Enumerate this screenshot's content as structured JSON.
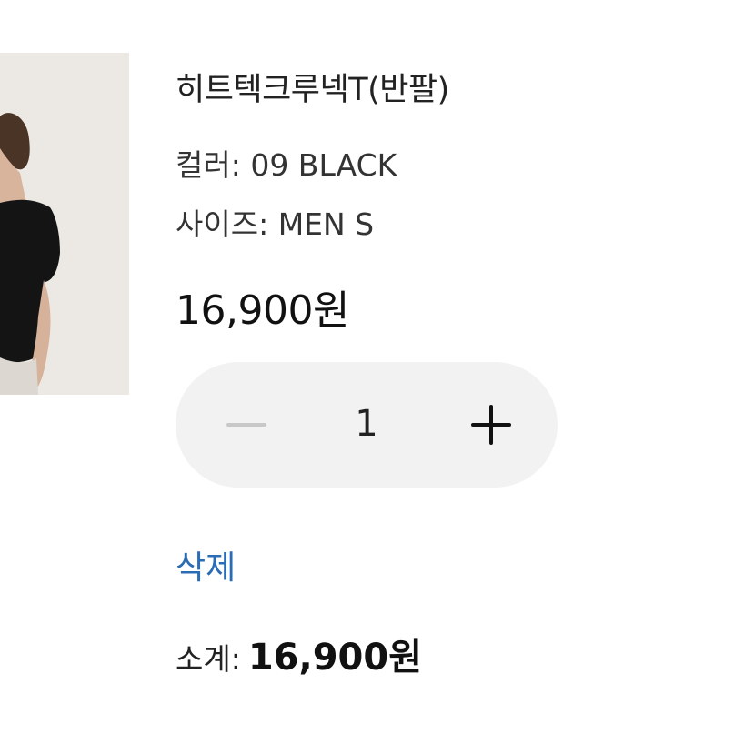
{
  "product": {
    "title": "히트텍크루넥T(반팔)",
    "color_line": "컬러: 09 BLACK",
    "size_line": "사이즈: MEN S",
    "price": "16,900원"
  },
  "quantity": {
    "value": "1",
    "decrement_icon": "minus-icon",
    "increment_icon": "plus-icon"
  },
  "actions": {
    "delete_label": "삭제"
  },
  "subtotal": {
    "label": "소계:",
    "value": "16,900원"
  },
  "colors": {
    "link": "#2b6cb6",
    "stepper_bg": "#f2f2f2",
    "minus_disabled": "#c8c8c8"
  }
}
